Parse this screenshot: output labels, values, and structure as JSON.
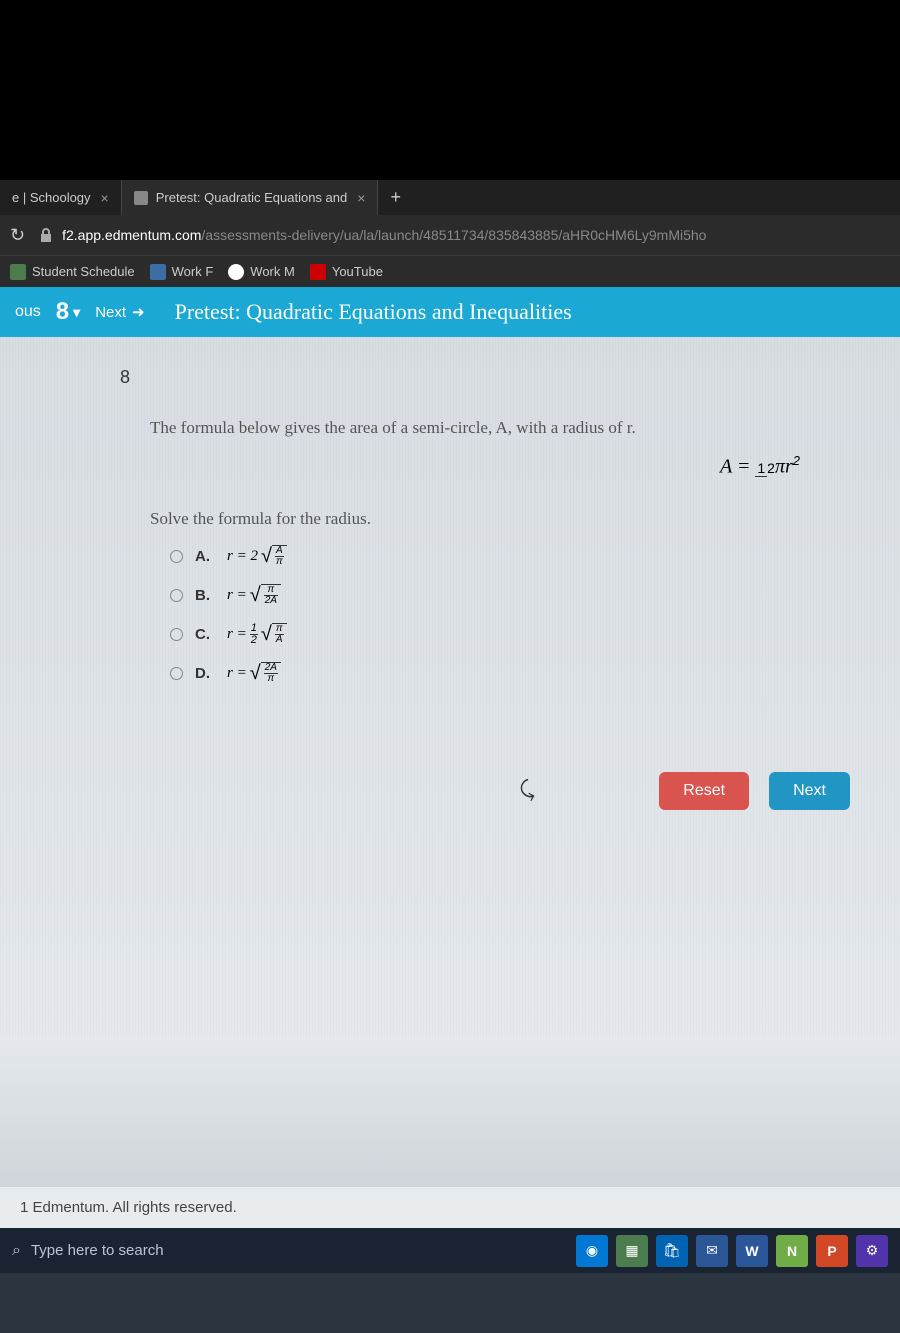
{
  "tabs": {
    "tab1": "e | Schoology",
    "tab2": "Pretest: Quadratic Equations and"
  },
  "url": {
    "domain": "f2.app.edmentum.com",
    "path": "/assessments-delivery/ua/la/launch/48511734/835843885/aHR0cHM6Ly9mMi5ho"
  },
  "bookmarks": {
    "b1": "Student Schedule",
    "b2": "Work F",
    "b3": "Work M",
    "b4": "YouTube"
  },
  "breadcrumb": {
    "prev": "ous",
    "num": "8",
    "next": "Next",
    "title": "Pretest: Quadratic Equations and Inequalities"
  },
  "question": {
    "number": "8",
    "line1": "The formula below gives the area of a semi-circle, A, with a radius of r.",
    "line2": "Solve the formula for the radius."
  },
  "options": {
    "a": "A.",
    "b": "B.",
    "c": "C.",
    "d": "D."
  },
  "buttons": {
    "reset": "Reset",
    "next": "Next"
  },
  "copyright": "1 Edmentum. All rights reserved.",
  "taskbar": {
    "search": "Type here to search"
  }
}
